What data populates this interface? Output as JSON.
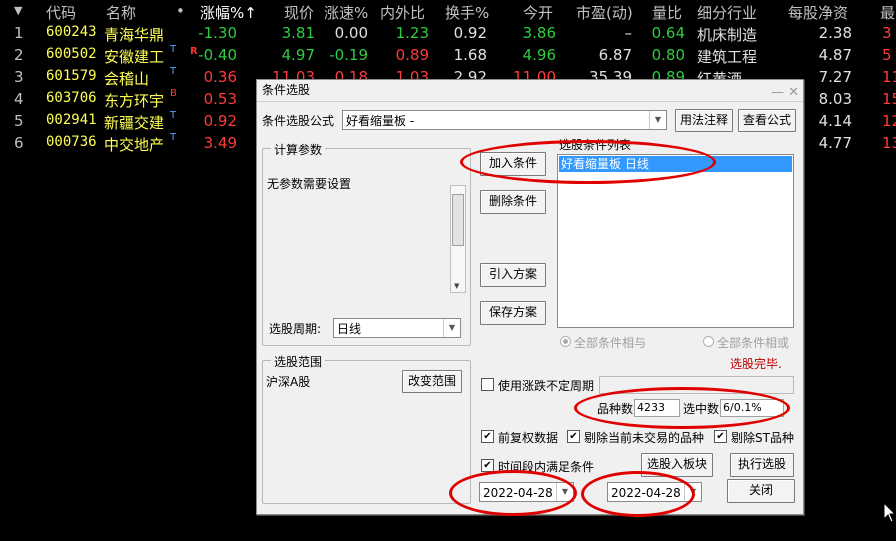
{
  "header": {
    "sort_arrow": "▼",
    "columns": [
      "代码",
      "名称",
      "•",
      "涨幅%↑",
      "现价",
      "涨速%",
      "内外比",
      "换手%",
      "今开",
      "市盈(动)",
      "量比",
      "细分行业",
      "每股净资",
      "最"
    ]
  },
  "rows": [
    {
      "idx": "1",
      "code": "600243",
      "name": "青海华鼎",
      "sup": "",
      "flag": "",
      "chg": "-1.30",
      "price": "3.81",
      "speed": "0.00",
      "io": "1.23",
      "turn": "0.92",
      "open": "3.86",
      "pe": "–",
      "vr": "0.64",
      "ind": "机床制造",
      "nav": "2.38",
      "last": "3"
    },
    {
      "idx": "2",
      "code": "600502",
      "name": "安徽建工",
      "sup": "T",
      "flag": "R",
      "chg": "-0.40",
      "price": "4.97",
      "speed": "-0.19",
      "io": "0.89",
      "turn": "1.68",
      "open": "4.96",
      "pe": "6.87",
      "vr": "0.80",
      "ind": "建筑工程",
      "nav": "4.87",
      "last": "5"
    },
    {
      "idx": "3",
      "code": "601579",
      "name": "会稽山",
      "sup": "T",
      "flag": "",
      "chg": "0.36",
      "price": "11.03",
      "speed": "0.18",
      "io": "1.03",
      "turn": "2.92",
      "open": "11.00",
      "pe": "35.39",
      "vr": "0.89",
      "ind": "红黄酒",
      "nav": "7.27",
      "last": "11"
    },
    {
      "idx": "4",
      "code": "603706",
      "name": "东方环宇",
      "sup": "B",
      "flag": "",
      "chg": "0.53",
      "price": "",
      "speed": "",
      "io": "",
      "turn": "",
      "open": "",
      "pe": "",
      "vr": "",
      "ind": "",
      "nav": "8.03",
      "last": "15"
    },
    {
      "idx": "5",
      "code": "002941",
      "name": "新疆交建",
      "sup": "T",
      "flag": "",
      "chg": "0.92",
      "price": "",
      "speed": "",
      "io": "",
      "turn": "",
      "open": "",
      "pe": "",
      "vr": "",
      "ind": "",
      "nav": "4.14",
      "last": "12"
    },
    {
      "idx": "6",
      "code": "000736",
      "name": "中交地产",
      "sup": "T",
      "flag": "",
      "chg": "3.49",
      "price": "",
      "speed": "",
      "io": "",
      "turn": "",
      "open": "",
      "pe": "",
      "vr": "",
      "ind": "",
      "nav": "4.77",
      "last": "13"
    }
  ],
  "dialog": {
    "title": "条件选股",
    "title_buttons": "— ✕",
    "formula_label": "条件选股公式",
    "formula_value": "好看缩量板    -",
    "usage_button": "用法注释",
    "view_formula_button": "查看公式",
    "params_group": "计算参数",
    "params_text": "无参数需要设置",
    "period_label": "选股周期:",
    "period_value": "日线",
    "range_group": "选股范围",
    "range_text": "沪深A股",
    "change_range_button": "改变范围",
    "add_condition_button": "加入条件",
    "delete_condition_button": "删除条件",
    "import_plan_button": "引入方案",
    "save_plan_button": "保存方案",
    "condition_list_label": "选股条件列表",
    "condition_items": [
      "好看缩量板  日线"
    ],
    "radio_and": "全部条件相与",
    "radio_or": "全部条件相或",
    "status": "选股完毕.",
    "use_float_period": "使用涨跌不定周期",
    "count_label": "品种数",
    "count_value": "4233",
    "selected_label": "选中数",
    "selected_value": "6/0.1%",
    "fq_label": "前复权数据",
    "exclude_untraded": "剔除当前未交易的品种",
    "exclude_st": "剔除ST品种",
    "time_range_label": "时间段内满足条件",
    "select_into_block_button": "选股入板块",
    "execute_button": "执行选股",
    "date_from": "2022-04-28",
    "date_to": "2022-04-28",
    "close_button": "关闭",
    "check_mark": "✔"
  },
  "colors": {
    "up": "#ff3a3a",
    "down": "#2ecc40",
    "code": "#ffff54",
    "annotation": "#e00000",
    "selection": "#3399ff"
  }
}
